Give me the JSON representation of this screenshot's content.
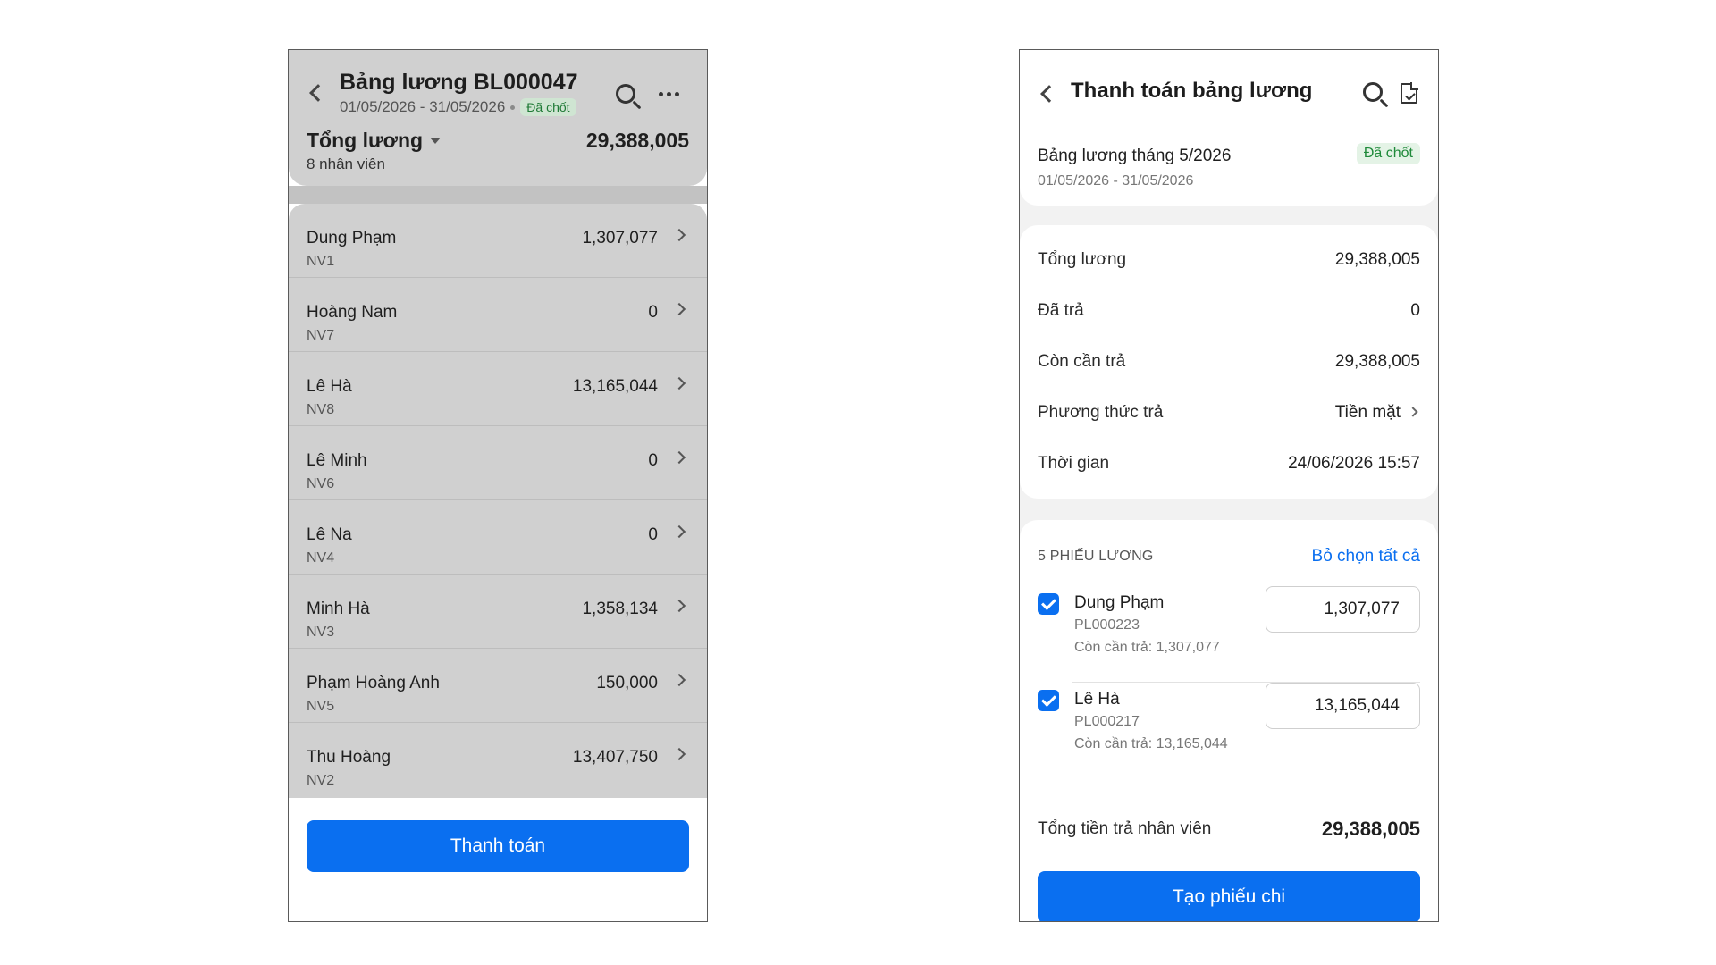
{
  "left_screen": {
    "header": {
      "title": "Bảng lương BL000047",
      "date_range": "01/05/2026 - 31/05/2026",
      "status_badge": "Đã chốt",
      "total_label": "Tổng lương",
      "total_value": "29,388,005",
      "employee_count": "8 nhân viên"
    },
    "employees": [
      {
        "name": "Dung Phạm",
        "code": "NV1",
        "amount": "1,307,077"
      },
      {
        "name": "Hoàng Nam",
        "code": "NV7",
        "amount": "0"
      },
      {
        "name": "Lê Hà",
        "code": "NV8",
        "amount": "13,165,044"
      },
      {
        "name": "Lê Minh",
        "code": "NV6",
        "amount": "0"
      },
      {
        "name": "Lê Na",
        "code": "NV4",
        "amount": "0"
      },
      {
        "name": "Minh Hà",
        "code": "NV3",
        "amount": "1,358,134"
      },
      {
        "name": "Phạm Hoàng Anh",
        "code": "NV5",
        "amount": "150,000"
      },
      {
        "name": "Thu Hoàng",
        "code": "NV2",
        "amount": "13,407,750"
      }
    ],
    "pay_button": "Thanh toán"
  },
  "right_screen": {
    "header": {
      "title": "Thanh toán bảng lương"
    },
    "period": {
      "title": "Bảng lương tháng 5/2026",
      "dates": "01/05/2026 - 31/05/2026",
      "status_badge": "Đã chốt"
    },
    "summary": [
      {
        "label": "Tổng lương",
        "value": "29,388,005"
      },
      {
        "label": "Đã trả",
        "value": "0"
      },
      {
        "label": "Còn cần trả",
        "value": "29,388,005"
      },
      {
        "label": "Phương thức trả",
        "value": "Tiền mặt"
      },
      {
        "label": "Thời gian",
        "value": "24/06/2026 15:57"
      }
    ],
    "slips_section": {
      "heading": "5 PHIẾU LƯƠNG",
      "deselect_all": "Bỏ chọn tất cả",
      "slips": [
        {
          "name": "Dung Phạm",
          "code": "PL000223",
          "remaining": "Còn cần trả: 1,307,077",
          "amount": "1,307,077",
          "checked": true
        },
        {
          "name": "Lê Hà",
          "code": "PL000217",
          "remaining": "Còn cần trả: 13,165,044",
          "amount": "13,165,044",
          "checked": true
        }
      ]
    },
    "total": {
      "label": "Tổng tiền trả nhân viên",
      "value": "29,388,005"
    },
    "create_button": "Tạo phiếu chi"
  }
}
